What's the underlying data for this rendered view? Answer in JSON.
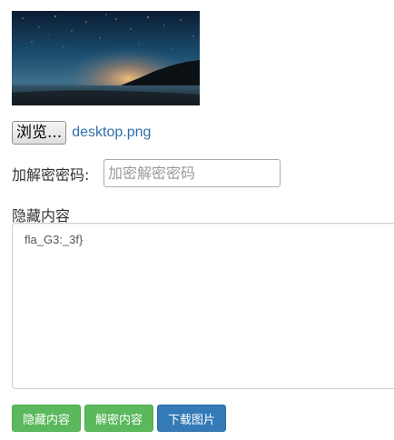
{
  "upload": {
    "browse_label": "浏览...",
    "file_name": "desktop.png"
  },
  "password": {
    "label": "加解密密码:",
    "value": "",
    "placeholder": "加密解密密码"
  },
  "hidden_content": {
    "label": "隐藏内容",
    "value": "fla_G3:_3f}"
  },
  "actions": {
    "hide_label": "隐藏内容",
    "decrypt_label": "解密内容",
    "download_label": "下载图片"
  },
  "colors": {
    "primary": "#337ab7",
    "success": "#5cb85c",
    "link": "#2f6fa8"
  }
}
